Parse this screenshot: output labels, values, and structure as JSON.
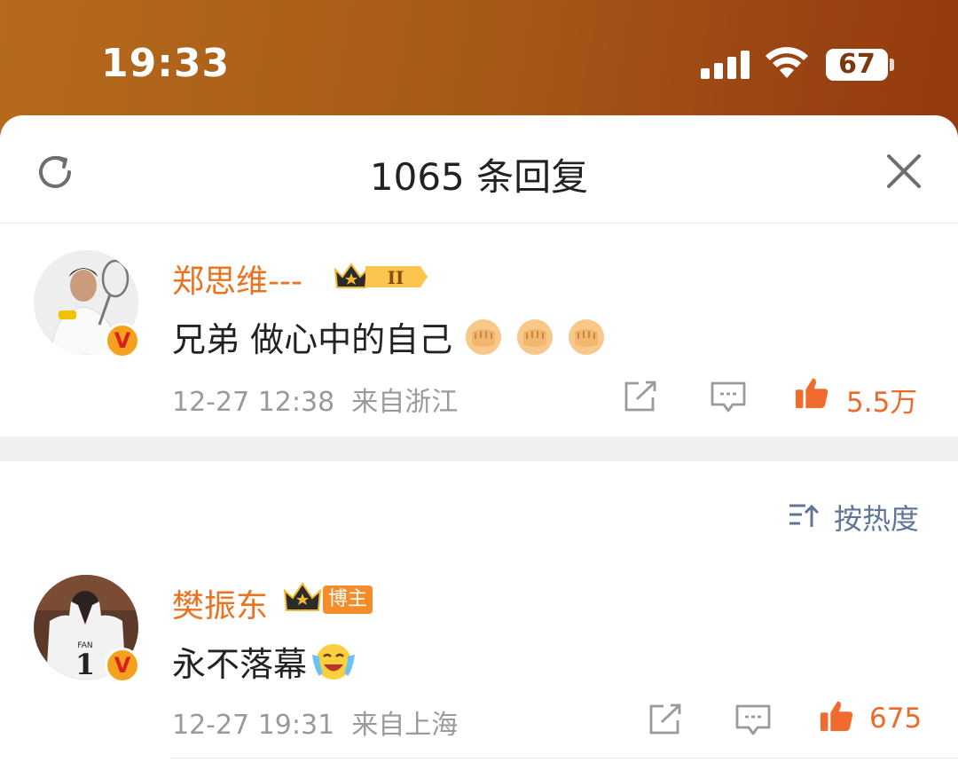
{
  "status_bar": {
    "time": "19:33",
    "battery": "67"
  },
  "sheet": {
    "title": "1065 条回复"
  },
  "comments": [
    {
      "username": "郑思维---",
      "text": "兄弟 做心中的自己",
      "emoji": "fist-icon",
      "emoji_count": 3,
      "time": "12-27 12:38",
      "location": "来自浙江",
      "likes": "5.5万",
      "badge_level": "II"
    },
    {
      "username": "樊振东",
      "text": "永不落幕",
      "emoji": "crying-laughing-icon",
      "time": "12-27 19:31",
      "location": "来自上海",
      "likes": "675",
      "tag": "博主"
    }
  ],
  "sort": {
    "label": "按热度"
  },
  "colors": {
    "accent": "#eb7320",
    "link": "#5f7699",
    "verified_bg": "#f6a11d",
    "verified_mark": "#d8211c"
  }
}
